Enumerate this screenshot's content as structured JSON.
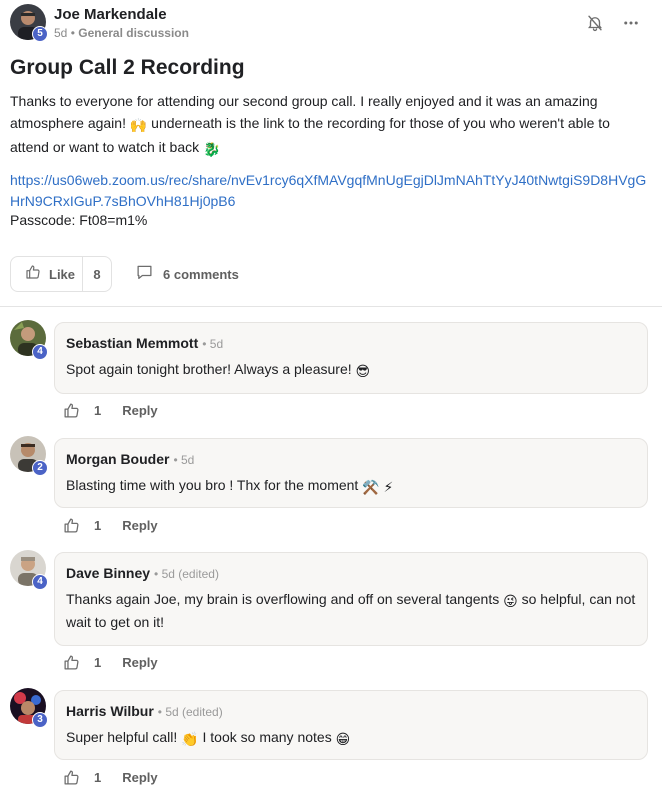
{
  "post": {
    "author": "Joe Markendale",
    "level": "5",
    "time": "5d",
    "separator": " • ",
    "category": "General discussion",
    "title": "Group Call 2 Recording",
    "body_1": "Thanks to everyone for attending our second group call. I really enjoyed and it was an amazing atmosphere again! ",
    "body_2": " underneath is the link to the recording for those of you who weren't able to attend or want to watch it back ",
    "link": "https://us06web.zoom.us/rec/share/nvEv1rcy6qXfMAVgqfMnUgEgjDlJmNAhTtYyJ40tNwtgiS9D8HVgGHrN9CRxIGuP.7sBhOVhH81Hj0pB6",
    "passcode": "Passcode: Ft08=m1%",
    "like_label": "Like",
    "like_count": "8",
    "comments_label": "6 comments"
  },
  "icons": {
    "header_bell": "bell-off-icon",
    "header_more": "more-horizontal-icon",
    "like": "thumbs-up-icon",
    "comment": "comment-icon"
  },
  "colors": {
    "link": "#2f6fc6",
    "level_badge": "#4b63c6",
    "bubble_bg": "#f8f7f5"
  },
  "comments": [
    {
      "author": "Sebastian Memmott",
      "level": "4",
      "meta": "• 5d",
      "text": "Spot again tonight brother! Always a pleasure! ",
      "emoji": "😎",
      "likes": "1",
      "reply": "Reply"
    },
    {
      "author": "Morgan Bouder",
      "level": "2",
      "meta": "• 5d",
      "text": "Blasting time with you bro ! Thx for the moment ",
      "emoji": "⚒️ ⚡",
      "likes": "1",
      "reply": "Reply"
    },
    {
      "author": "Dave Binney",
      "level": "4",
      "meta": "• 5d (edited)",
      "text": "Thanks again Joe, my brain is overflowing and off on several tangents ",
      "emoji_mid": "😜",
      "text_2": " so helpful, can not wait to get on it!",
      "likes": "1",
      "reply": "Reply"
    },
    {
      "author": "Harris Wilbur",
      "level": "3",
      "meta": "• 5d (edited)",
      "text": "Super helpful call! ",
      "emoji_mid": "👏",
      "text_2": " I took so many notes ",
      "emoji": "😁",
      "likes": "1",
      "reply": "Reply"
    }
  ]
}
